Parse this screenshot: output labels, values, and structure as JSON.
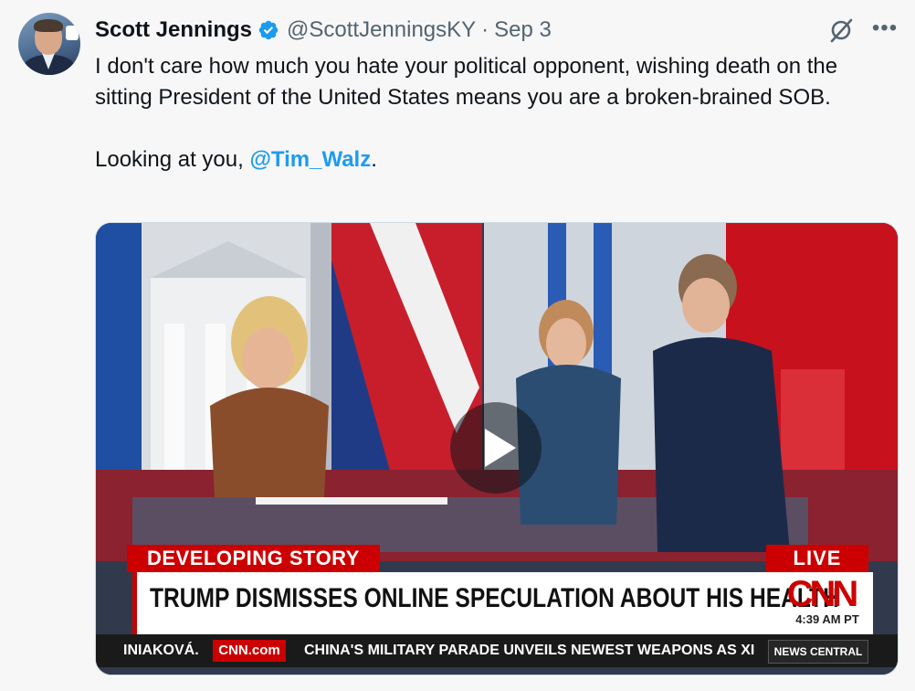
{
  "author": {
    "name": "Scott Jennings",
    "handle": "@ScottJenningsKY",
    "separator": "·",
    "date": "Sep 3"
  },
  "icons": {
    "verified": "verified-badge-icon",
    "grok": "grok-icon",
    "more": "more-options-icon",
    "play": "play-icon"
  },
  "tweet": {
    "line1": "I don't care how much you hate your political opponent, wishing death on the sitting President of the United States means you are a broken-brained SOB.",
    "line2_prefix": "Looking at you, ",
    "mention": "@Tim_Walz",
    "line2_suffix": "."
  },
  "video": {
    "banner": "DEVELOPING STORY",
    "live": "LIVE",
    "headline": "TRUMP DISMISSES ONLINE SPECULATION ABOUT HIS HEALTH",
    "network_logo": "CNN",
    "time": "4:39 AM PT",
    "ticker_left": "INIAKOVÁ.",
    "ticker_brand": "CNN.com",
    "ticker_text": "CHINA'S MILITARY PARADE UNVEILS NEWEST WEAPONS AS XI",
    "ticker_tag": "NEWS CENTRAL"
  },
  "colors": {
    "accent_blue": "#1d9bf0",
    "cnn_red": "#cc0000",
    "text_primary": "#0f1419",
    "text_secondary": "#536471"
  }
}
